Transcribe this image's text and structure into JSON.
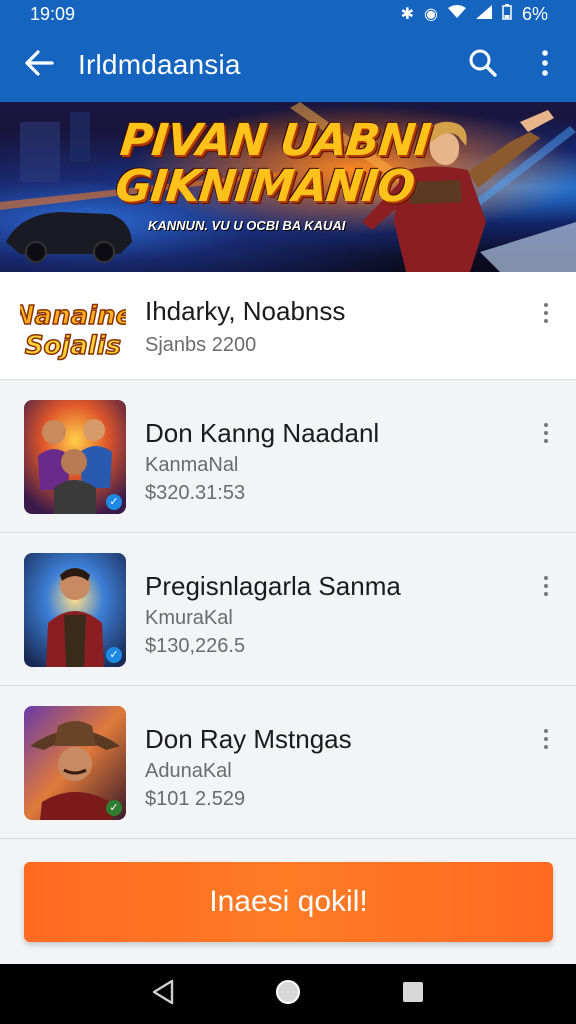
{
  "status_bar": {
    "time": "19:09",
    "battery": "6%"
  },
  "app_bar": {
    "title": "Irldmdaansia"
  },
  "banner": {
    "title_line1": "PIVAN UABNI",
    "title_line2": "GIKNIMANIO",
    "subtitle": "KANNUN. VU U OCBI BA KAUAI"
  },
  "list": {
    "first": {
      "logo_text_top": "Nanaine",
      "logo_text_bottom": "Sojalis",
      "name": "Ihdarky, Noabnss",
      "meta": "Sjanbs 2200"
    },
    "items": [
      {
        "name": "Don Kanng Naadanl",
        "meta1": "KanmaNal",
        "meta2": "$320.31:53"
      },
      {
        "name": "Pregisnlagarla Sanma",
        "meta1": "KmuraKal",
        "meta2": "$130,226.5"
      },
      {
        "name": "Don Ray Mstngas",
        "meta1": "AdunaKal",
        "meta2": "$101 2.529"
      }
    ]
  },
  "cta": {
    "label": "Inaesi qokil!"
  },
  "colors": {
    "primary": "#1565c0",
    "cta": "#ff6a22",
    "background": "#f1f2f4"
  },
  "icons": [
    "back-arrow-icon",
    "search-icon",
    "more-vert-icon",
    "nav-back-icon",
    "nav-home-icon",
    "nav-recents-icon"
  ]
}
